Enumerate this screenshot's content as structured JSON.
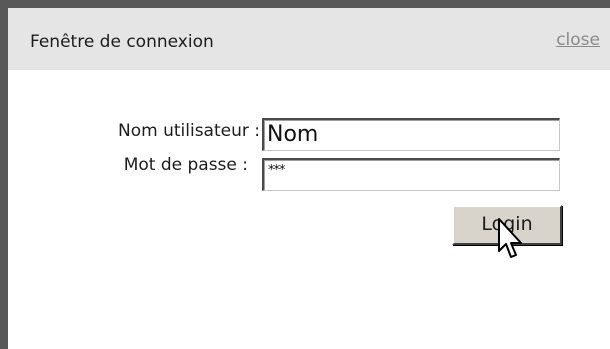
{
  "window": {
    "title": "Fenêtre de connexion",
    "close_label": "close"
  },
  "form": {
    "username_label": "Nom utilisateur :",
    "username_value": "Nom",
    "password_label": "Mot de passe :",
    "password_value": "***",
    "login_label": "Login"
  },
  "icons": {
    "cursor": "mouse-pointer-icon"
  },
  "colors": {
    "frame": "#585858",
    "titlebar_bg": "#e5e5e5",
    "button_bg": "#d8d4cc",
    "close_link": "#8a8a8a"
  }
}
